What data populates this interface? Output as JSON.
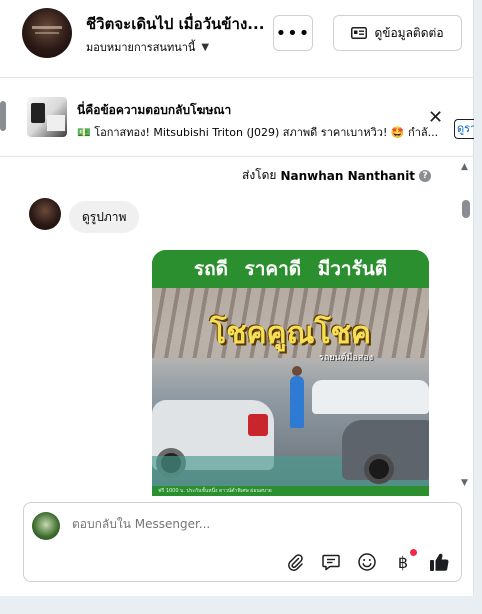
{
  "header": {
    "page_title": "ชีวิตจะเดินไป เมื่อวันข้าง...",
    "assign_label": "มอบหมายการสนทนานี้",
    "more_label": "•••",
    "contact_button_label": "ดูข้อมูลติดต่อ"
  },
  "ad_reply": {
    "title": "นี่คือข้อความตอบกลับโฆษณา",
    "text": "💵 โอกาสทอง! Mitsubishi Triton (J029) สภาพดี ราคาเบาหวิว! 🤩 กำลั...",
    "extra_label": "ดูรา"
  },
  "conversation": {
    "sent_by_prefix": "ส่งโดย",
    "sent_by_name": "Nanwhan Nanthanit",
    "incoming_bubble": "ดูรูปภาพ",
    "attachment": {
      "banner_text": "รถดี ราคาดี มีวารันตี",
      "headline": "โชคคูณโชค",
      "subline": "รถยนต์มือสอง",
      "footer_text": "ฟรี 1000 บ. ประกันชั้นหนึ่ง   ดาวน์ต่ำพิเศษ   ผ่อนสบาย"
    }
  },
  "composer": {
    "placeholder": "ตอบกลับใน Messenger..."
  },
  "colors": {
    "accent_green": "#2b8f2f",
    "headline_yellow": "#f6de55",
    "notification_dot": "#f0284a"
  }
}
